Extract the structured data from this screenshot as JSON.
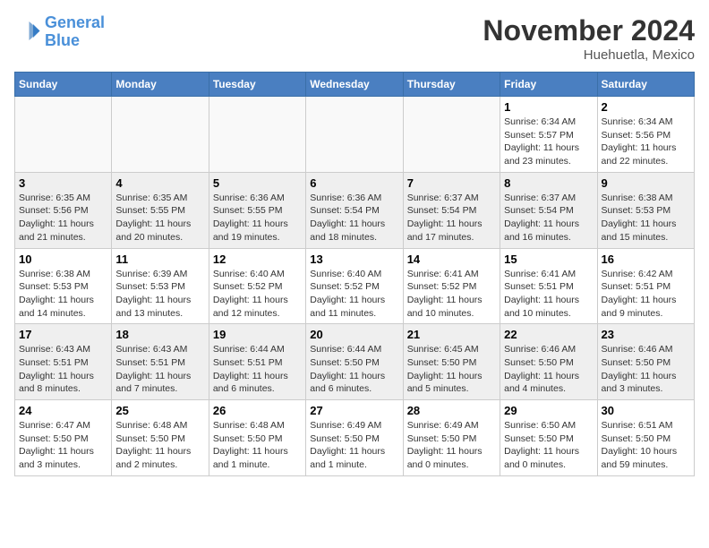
{
  "header": {
    "logo_line1": "General",
    "logo_line2": "Blue",
    "month_title": "November 2024",
    "location": "Huehuetla, Mexico"
  },
  "days_of_week": [
    "Sunday",
    "Monday",
    "Tuesday",
    "Wednesday",
    "Thursday",
    "Friday",
    "Saturday"
  ],
  "weeks": [
    [
      {
        "day": "",
        "info": ""
      },
      {
        "day": "",
        "info": ""
      },
      {
        "day": "",
        "info": ""
      },
      {
        "day": "",
        "info": ""
      },
      {
        "day": "",
        "info": ""
      },
      {
        "day": "1",
        "info": "Sunrise: 6:34 AM\nSunset: 5:57 PM\nDaylight: 11 hours and 23 minutes."
      },
      {
        "day": "2",
        "info": "Sunrise: 6:34 AM\nSunset: 5:56 PM\nDaylight: 11 hours and 22 minutes."
      }
    ],
    [
      {
        "day": "3",
        "info": "Sunrise: 6:35 AM\nSunset: 5:56 PM\nDaylight: 11 hours and 21 minutes."
      },
      {
        "day": "4",
        "info": "Sunrise: 6:35 AM\nSunset: 5:55 PM\nDaylight: 11 hours and 20 minutes."
      },
      {
        "day": "5",
        "info": "Sunrise: 6:36 AM\nSunset: 5:55 PM\nDaylight: 11 hours and 19 minutes."
      },
      {
        "day": "6",
        "info": "Sunrise: 6:36 AM\nSunset: 5:54 PM\nDaylight: 11 hours and 18 minutes."
      },
      {
        "day": "7",
        "info": "Sunrise: 6:37 AM\nSunset: 5:54 PM\nDaylight: 11 hours and 17 minutes."
      },
      {
        "day": "8",
        "info": "Sunrise: 6:37 AM\nSunset: 5:54 PM\nDaylight: 11 hours and 16 minutes."
      },
      {
        "day": "9",
        "info": "Sunrise: 6:38 AM\nSunset: 5:53 PM\nDaylight: 11 hours and 15 minutes."
      }
    ],
    [
      {
        "day": "10",
        "info": "Sunrise: 6:38 AM\nSunset: 5:53 PM\nDaylight: 11 hours and 14 minutes."
      },
      {
        "day": "11",
        "info": "Sunrise: 6:39 AM\nSunset: 5:53 PM\nDaylight: 11 hours and 13 minutes."
      },
      {
        "day": "12",
        "info": "Sunrise: 6:40 AM\nSunset: 5:52 PM\nDaylight: 11 hours and 12 minutes."
      },
      {
        "day": "13",
        "info": "Sunrise: 6:40 AM\nSunset: 5:52 PM\nDaylight: 11 hours and 11 minutes."
      },
      {
        "day": "14",
        "info": "Sunrise: 6:41 AM\nSunset: 5:52 PM\nDaylight: 11 hours and 10 minutes."
      },
      {
        "day": "15",
        "info": "Sunrise: 6:41 AM\nSunset: 5:51 PM\nDaylight: 11 hours and 10 minutes."
      },
      {
        "day": "16",
        "info": "Sunrise: 6:42 AM\nSunset: 5:51 PM\nDaylight: 11 hours and 9 minutes."
      }
    ],
    [
      {
        "day": "17",
        "info": "Sunrise: 6:43 AM\nSunset: 5:51 PM\nDaylight: 11 hours and 8 minutes."
      },
      {
        "day": "18",
        "info": "Sunrise: 6:43 AM\nSunset: 5:51 PM\nDaylight: 11 hours and 7 minutes."
      },
      {
        "day": "19",
        "info": "Sunrise: 6:44 AM\nSunset: 5:51 PM\nDaylight: 11 hours and 6 minutes."
      },
      {
        "day": "20",
        "info": "Sunrise: 6:44 AM\nSunset: 5:50 PM\nDaylight: 11 hours and 6 minutes."
      },
      {
        "day": "21",
        "info": "Sunrise: 6:45 AM\nSunset: 5:50 PM\nDaylight: 11 hours and 5 minutes."
      },
      {
        "day": "22",
        "info": "Sunrise: 6:46 AM\nSunset: 5:50 PM\nDaylight: 11 hours and 4 minutes."
      },
      {
        "day": "23",
        "info": "Sunrise: 6:46 AM\nSunset: 5:50 PM\nDaylight: 11 hours and 3 minutes."
      }
    ],
    [
      {
        "day": "24",
        "info": "Sunrise: 6:47 AM\nSunset: 5:50 PM\nDaylight: 11 hours and 3 minutes."
      },
      {
        "day": "25",
        "info": "Sunrise: 6:48 AM\nSunset: 5:50 PM\nDaylight: 11 hours and 2 minutes."
      },
      {
        "day": "26",
        "info": "Sunrise: 6:48 AM\nSunset: 5:50 PM\nDaylight: 11 hours and 1 minute."
      },
      {
        "day": "27",
        "info": "Sunrise: 6:49 AM\nSunset: 5:50 PM\nDaylight: 11 hours and 1 minute."
      },
      {
        "day": "28",
        "info": "Sunrise: 6:49 AM\nSunset: 5:50 PM\nDaylight: 11 hours and 0 minutes."
      },
      {
        "day": "29",
        "info": "Sunrise: 6:50 AM\nSunset: 5:50 PM\nDaylight: 11 hours and 0 minutes."
      },
      {
        "day": "30",
        "info": "Sunrise: 6:51 AM\nSunset: 5:50 PM\nDaylight: 10 hours and 59 minutes."
      }
    ]
  ]
}
